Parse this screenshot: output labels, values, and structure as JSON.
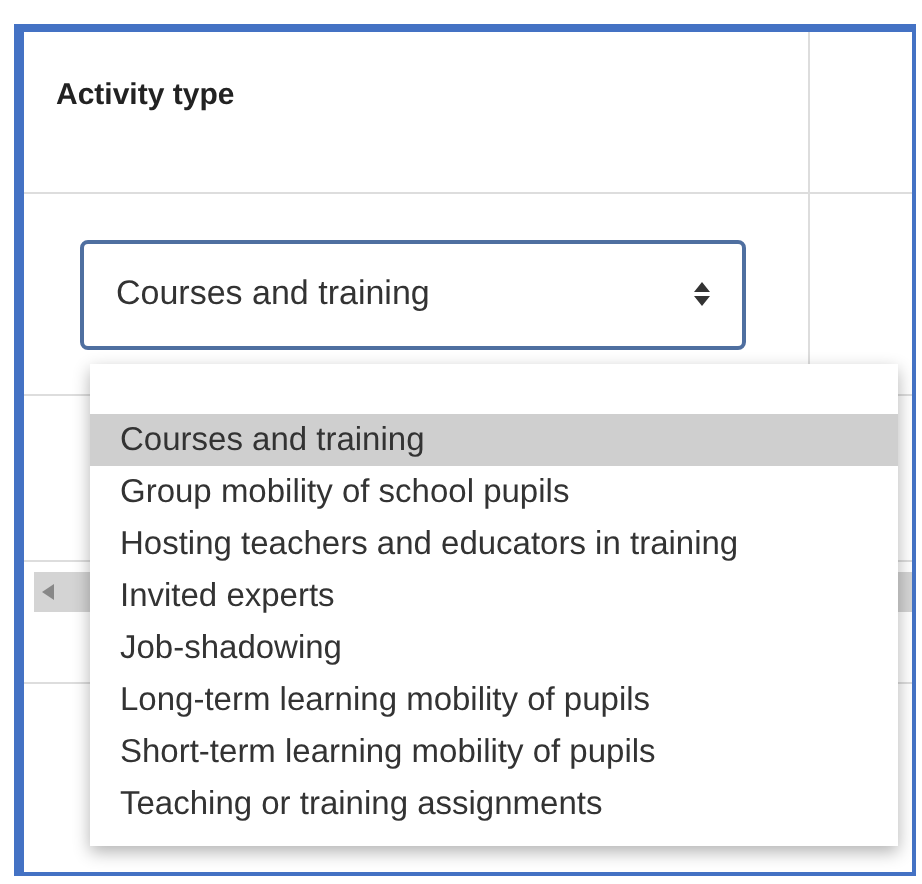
{
  "table": {
    "columns": [
      {
        "label": "Activity type"
      }
    ]
  },
  "select": {
    "value": "Courses and training",
    "expanded": true
  },
  "options": [
    {
      "label": "Courses and training",
      "selected": true
    },
    {
      "label": "Group mobility of school pupils",
      "selected": false
    },
    {
      "label": "Hosting teachers and educators in training",
      "selected": false
    },
    {
      "label": "Invited experts",
      "selected": false
    },
    {
      "label": "Job-shadowing",
      "selected": false
    },
    {
      "label": "Long-term learning mobility of pupils",
      "selected": false
    },
    {
      "label": "Short-term learning mobility of pupils",
      "selected": false
    },
    {
      "label": "Teaching or training assignments",
      "selected": false
    }
  ]
}
